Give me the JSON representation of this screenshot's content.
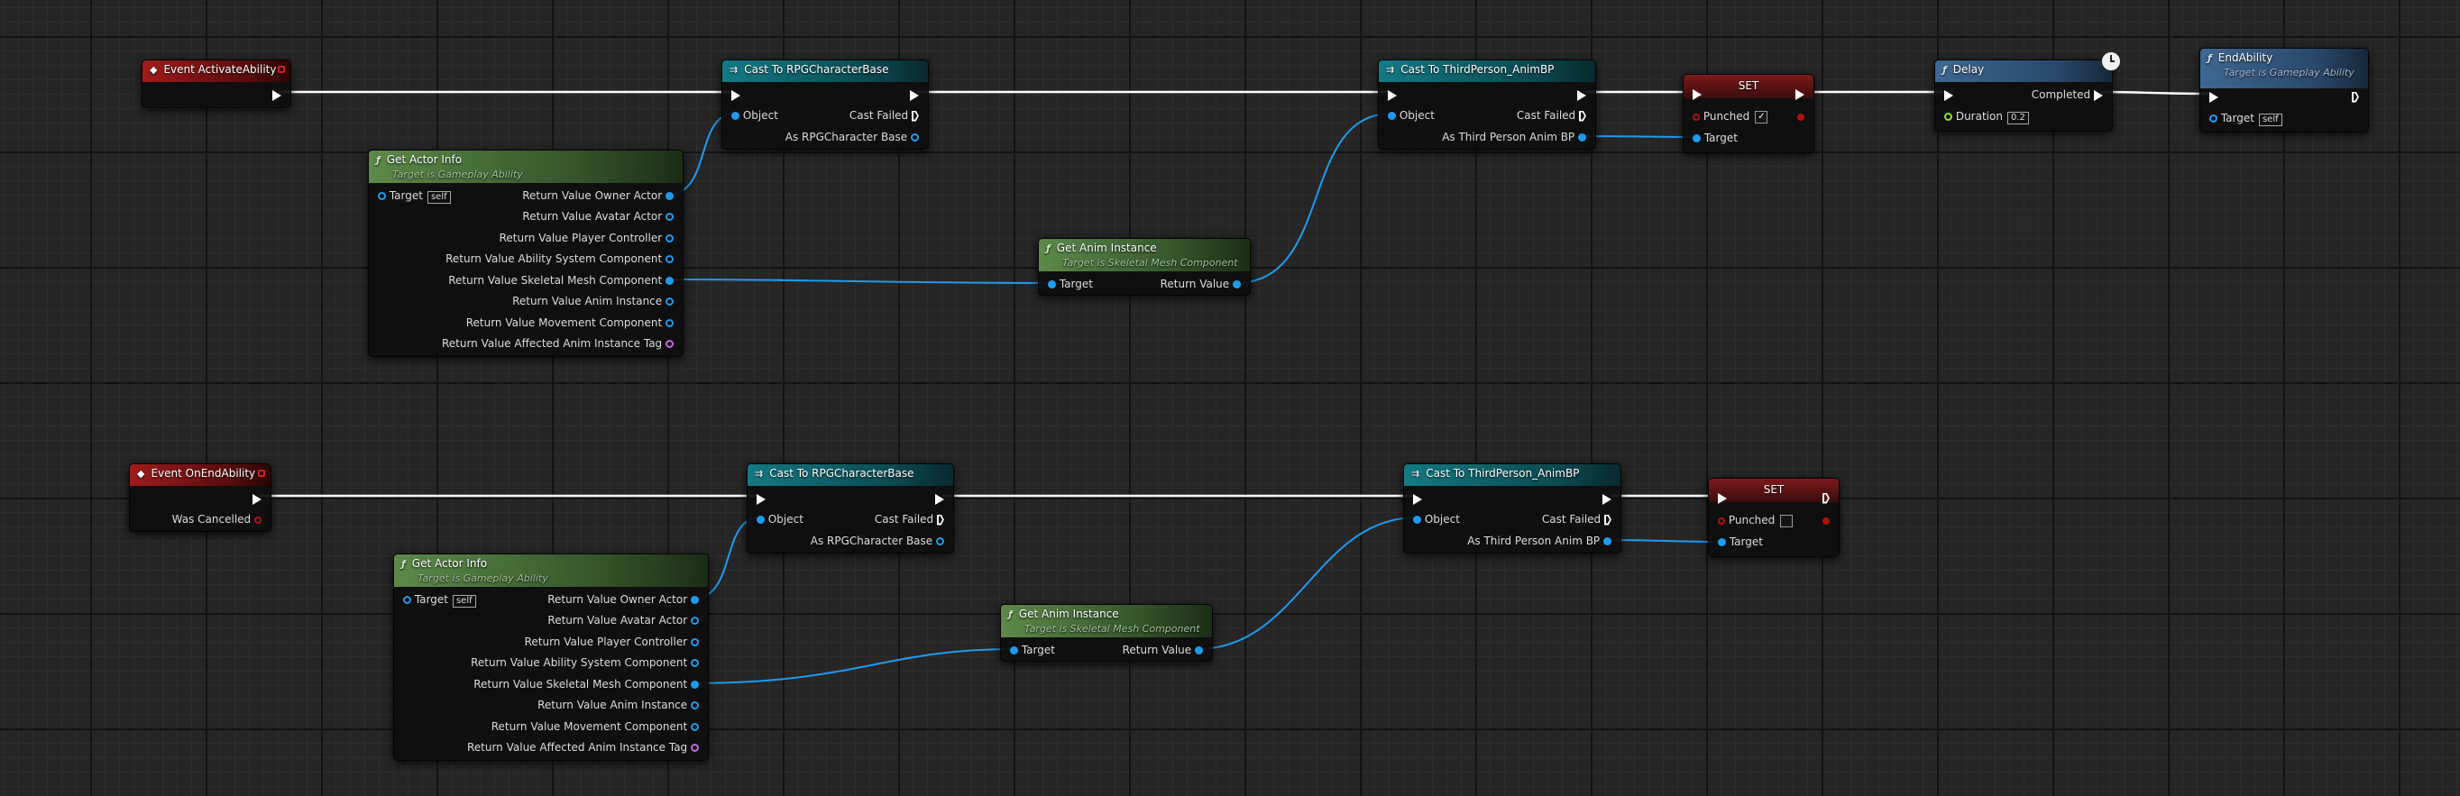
{
  "colors": {
    "exec_wire": "#ffffff",
    "object_wire": "#1e9bf0",
    "event_header": "#a01c1c",
    "cast_header": "#147a85",
    "function_header": "#5d8a4a",
    "latent_header": "#3f6892",
    "set_header": "#7d1a1a"
  },
  "nodes": {
    "event_activate": {
      "title": "Event ActivateAbility",
      "icon": "event-diamond-icon"
    },
    "cast_rpg_1": {
      "title": "Cast To RPGCharacterBase",
      "object": "Object",
      "cast_failed": "Cast Failed",
      "as_out": "As RPGCharacter Base"
    },
    "get_actor_info_1": {
      "title": "Get Actor Info",
      "subtitle": "Target is Gameplay Ability",
      "target": "Target",
      "target_value": "self",
      "outputs": [
        "Return Value Owner Actor",
        "Return Value Avatar Actor",
        "Return Value Player Controller",
        "Return Value Ability System Component",
        "Return Value Skeletal Mesh Component",
        "Return Value Anim Instance",
        "Return Value Movement Component",
        "Return Value Affected Anim Instance Tag"
      ]
    },
    "get_anim_1": {
      "title": "Get Anim Instance",
      "subtitle": "Target is Skeletal Mesh Component",
      "target": "Target",
      "return": "Return Value"
    },
    "cast_tp_1": {
      "title": "Cast To ThirdPerson_AnimBP",
      "object": "Object",
      "cast_failed": "Cast Failed",
      "as_out": "As Third Person Anim BP"
    },
    "set_1": {
      "title": "SET",
      "var": "Punched",
      "checked": "✓",
      "target": "Target"
    },
    "delay": {
      "title": "Delay",
      "completed": "Completed",
      "duration": "Duration",
      "duration_value": "0.2"
    },
    "end_ability": {
      "title": "EndAbility",
      "subtitle": "Target is Gameplay Ability",
      "target": "Target",
      "target_value": "self"
    },
    "event_end": {
      "title": "Event OnEndAbility",
      "was_cancelled": "Was Cancelled"
    },
    "cast_rpg_2": {
      "title": "Cast To RPGCharacterBase",
      "object": "Object",
      "cast_failed": "Cast Failed",
      "as_out": "As RPGCharacter Base"
    },
    "get_actor_info_2": {
      "title": "Get Actor Info",
      "subtitle": "Target is Gameplay Ability",
      "target": "Target",
      "target_value": "self",
      "outputs": [
        "Return Value Owner Actor",
        "Return Value Avatar Actor",
        "Return Value Player Controller",
        "Return Value Ability System Component",
        "Return Value Skeletal Mesh Component",
        "Return Value Anim Instance",
        "Return Value Movement Component",
        "Return Value Affected Anim Instance Tag"
      ]
    },
    "get_anim_2": {
      "title": "Get Anim Instance",
      "subtitle": "Target is Skeletal Mesh Component",
      "target": "Target",
      "return": "Return Value"
    },
    "cast_tp_2": {
      "title": "Cast To ThirdPerson_AnimBP",
      "object": "Object",
      "cast_failed": "Cast Failed",
      "as_out": "As Third Person Anim BP"
    },
    "set_2": {
      "title": "SET",
      "var": "Punched",
      "checked": "",
      "target": "Target"
    }
  }
}
